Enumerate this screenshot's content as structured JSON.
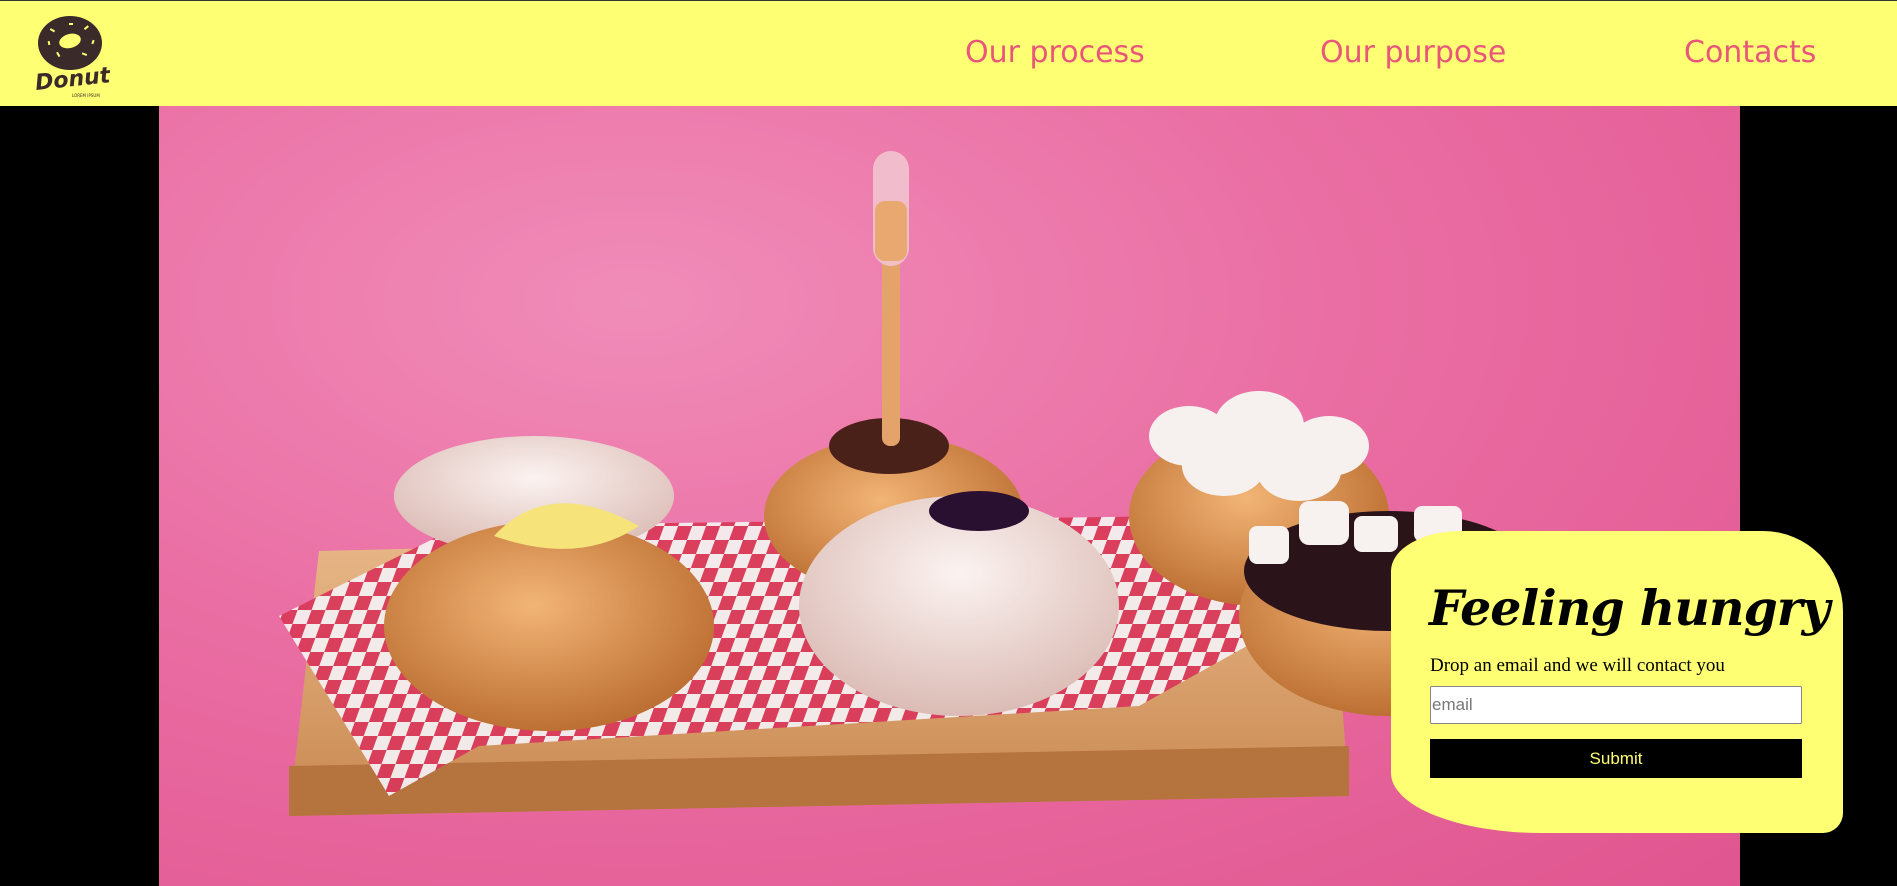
{
  "brand": {
    "logo_text": "Donuts",
    "logo_subtext": "LOREM IPSUM"
  },
  "nav": {
    "items": [
      {
        "label": "Our process"
      },
      {
        "label": "Our purpose"
      },
      {
        "label": "Contacts"
      }
    ]
  },
  "colors": {
    "header_bg": "#ffff73",
    "nav_text": "#e8577a",
    "hero_bg": "#ea6ea3",
    "button_bg": "#000000",
    "button_text": "#ffff73"
  },
  "hero": {
    "media": "donuts-on-board-image"
  },
  "contact_card": {
    "title": "Feeling hungry yet?",
    "subtitle": "Drop an email and we will contact you",
    "email_placeholder": "email",
    "email_value": "",
    "submit_label": "Submit"
  }
}
